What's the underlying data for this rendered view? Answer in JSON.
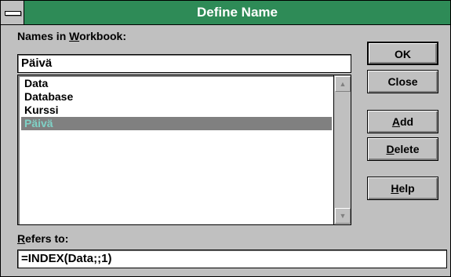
{
  "window": {
    "title": "Define Name"
  },
  "names": {
    "label_pre": "Names in ",
    "label_accel": "W",
    "label_post": "orkbook:",
    "input_value": "Päivä",
    "list": [
      "Data",
      "Database",
      "Kurssi",
      "Päivä"
    ],
    "selected_index": 3
  },
  "refers": {
    "label_accel": "R",
    "label_post": "efers to:",
    "value": "=INDEX(Data;;1)"
  },
  "buttons": {
    "ok": "OK",
    "close": "Close",
    "add": "Add",
    "delete": "Delete",
    "help": "Help"
  },
  "icons": {
    "system_menu": "system-menu-icon",
    "scroll_up": "scroll-up-arrow-icon",
    "scroll_down": "scroll-down-arrow-icon"
  },
  "colors": {
    "title_bar": "#2e8b57",
    "selection": "#808080",
    "selection_text": "#7fd1c6"
  }
}
